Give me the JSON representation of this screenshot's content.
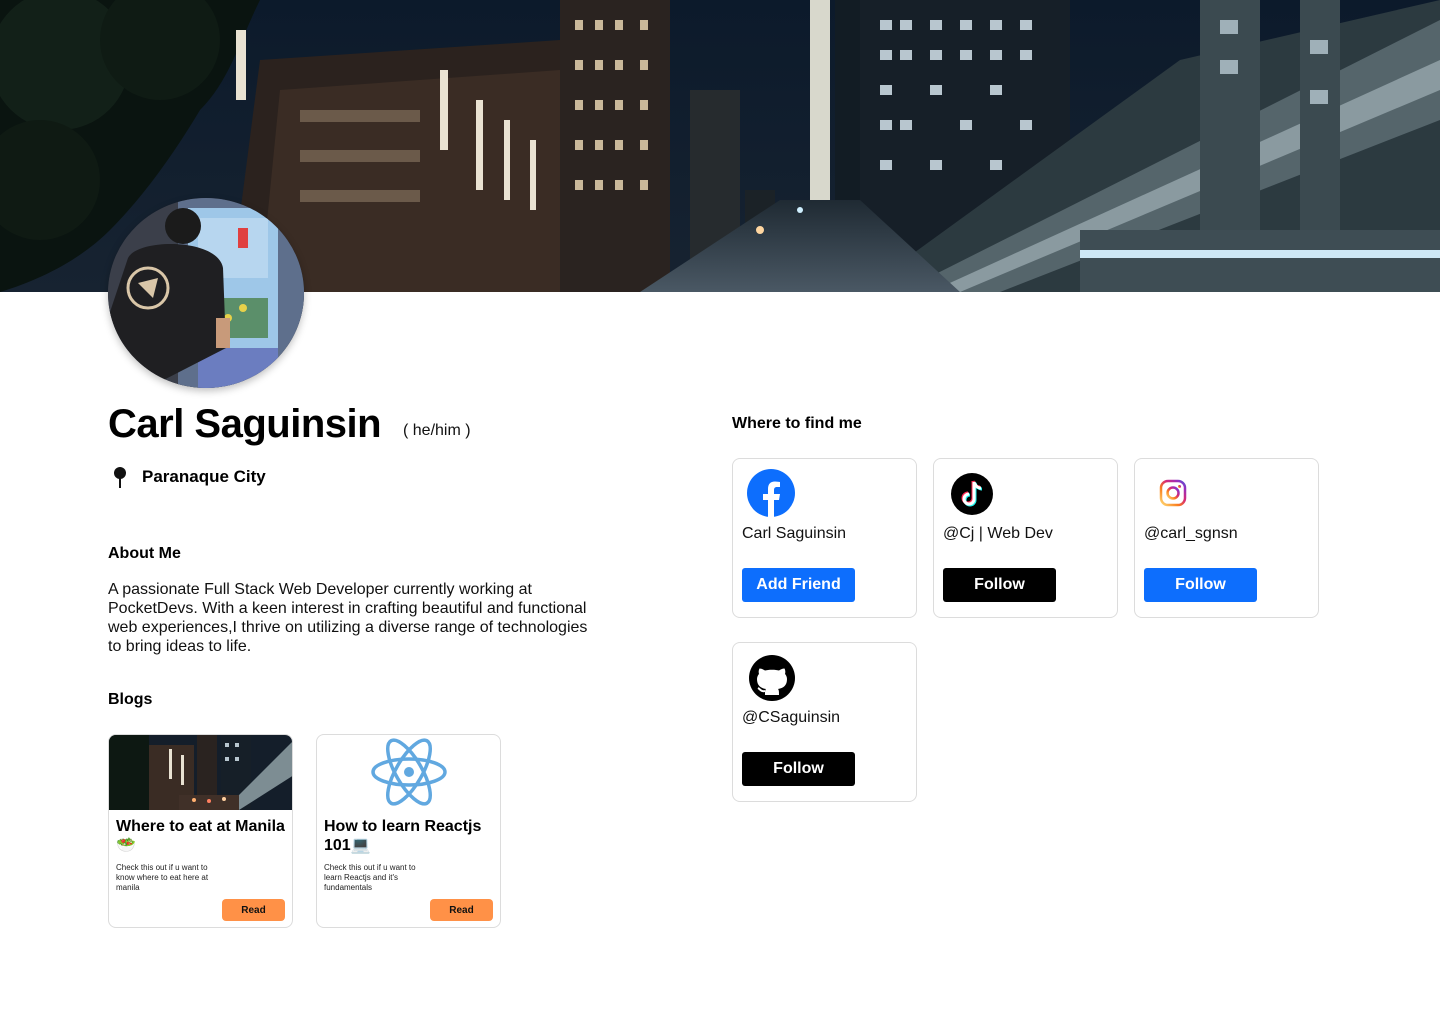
{
  "profile": {
    "name": "Carl Saguinsin",
    "pronouns": "( he/him )",
    "location": "Paranaque City"
  },
  "about": {
    "title": "About Me",
    "text": "A passionate Full Stack Web Developer currently working at PocketDevs. With a keen interest in crafting beautiful and functional web experiences,I thrive on utilizing a diverse range of technologies to bring ideas to life."
  },
  "blogs": {
    "title": "Blogs",
    "items": [
      {
        "title": "Where to eat at Manila🥗",
        "desc": "Check this out if u want to know where to eat here at manila",
        "button": "Read"
      },
      {
        "title": "How to learn Reactjs 101💻",
        "desc": "Check this out if u want to learn Reactjs and it's fundamentals",
        "button": "Read"
      }
    ]
  },
  "socials": {
    "title": "Where to find me",
    "items": [
      {
        "platform": "facebook",
        "icon": "facebook-icon",
        "handle": "Carl Saguinsin",
        "button": "Add Friend",
        "button_color": "#0d6efd"
      },
      {
        "platform": "tiktok",
        "icon": "tiktok-icon",
        "handle": "@Cj | Web Dev",
        "button": "Follow",
        "button_color": "#000000"
      },
      {
        "platform": "instagram",
        "icon": "instagram-icon",
        "handle": "@carl_sgnsn",
        "button": "Follow",
        "button_color": "#0d6efd"
      },
      {
        "platform": "github",
        "icon": "github-icon",
        "handle": "@CSaguinsin",
        "button": "Follow",
        "button_color": "#000000"
      }
    ]
  },
  "colors": {
    "primary_blue": "#0d6efd",
    "read_button": "#ff9147",
    "react_blue": "#61a8e0"
  }
}
